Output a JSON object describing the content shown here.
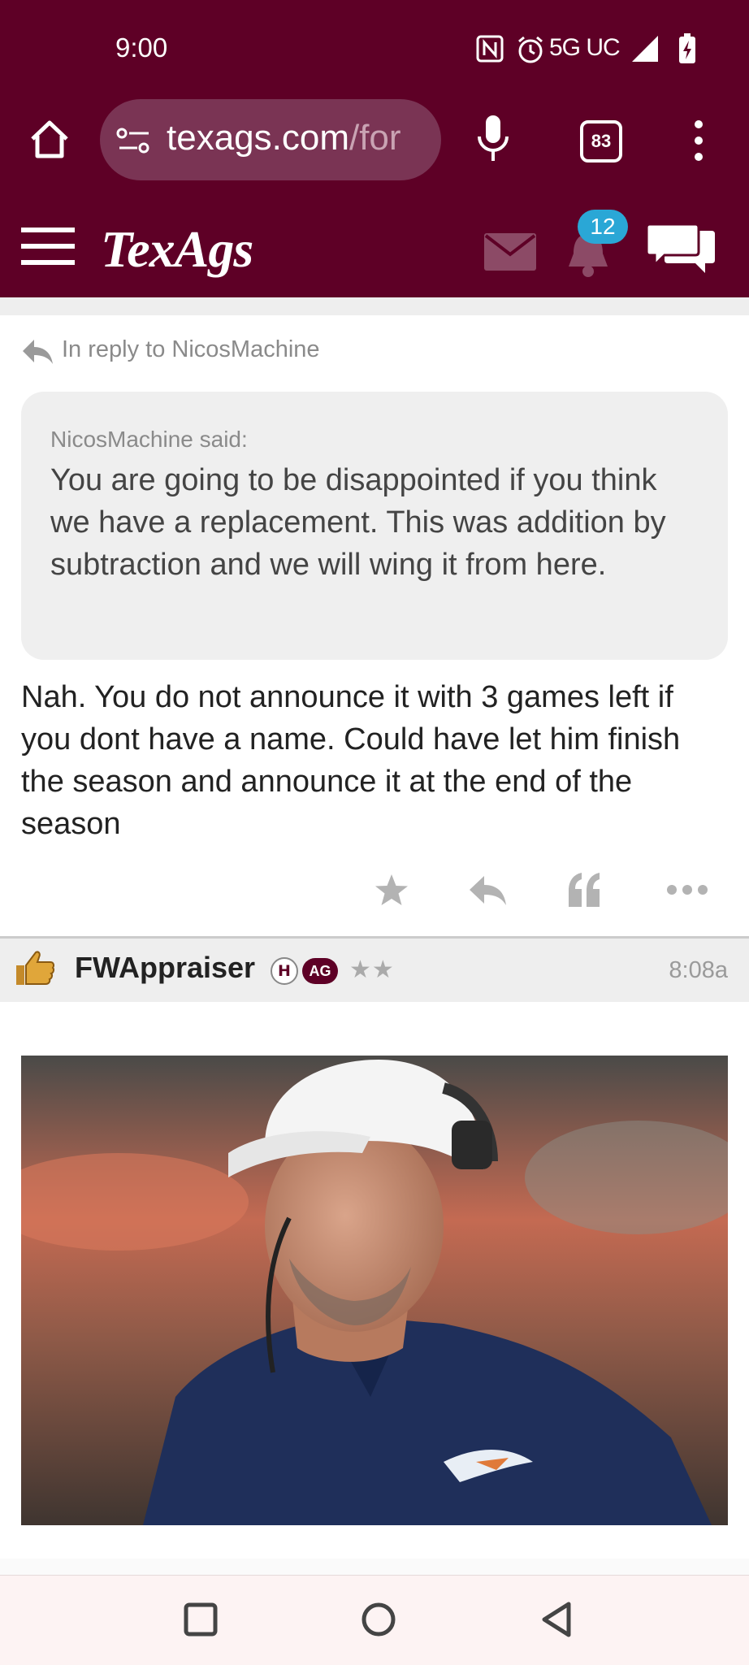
{
  "status_bar": {
    "time": "9:00",
    "network": "5G UC",
    "icons": [
      "nfc-icon",
      "alarm-icon",
      "signal-icon",
      "battery-charging-icon"
    ]
  },
  "browser": {
    "url_host": "texags.com",
    "url_path": "/for",
    "tab_count": "83",
    "icons": [
      "home-icon",
      "site-info-icon",
      "mic-icon",
      "tabs-icon",
      "more-vert-icon"
    ]
  },
  "site_header": {
    "logo": "TexAgs",
    "notifications_count": "12",
    "icons": [
      "hamburger-menu-icon",
      "mail-icon",
      "bell-icon",
      "chat-icon"
    ]
  },
  "post": {
    "reply_to": "In reply to NicosMachine",
    "quote_author": "NicosMachine said:",
    "quote_text": "You are going to be disappointed if you think we have a replacement. This was addition by subtraction and we will wing it from here.",
    "body": "Nah. You do not announce it with 3 games left if you dont have a name. Could have let him finish the season and announce it at the end of the season",
    "actions": [
      "star-icon",
      "reply-icon",
      "quote-icon",
      "more-horiz-icon"
    ]
  },
  "next_post": {
    "author": "FWAppraiser",
    "badge_h": "H",
    "badge_ag": "AG",
    "stars": "★★",
    "time": "8:08a",
    "icons": [
      "thumbs-up-avatar-icon"
    ],
    "image_desc_icon": "coach-photo"
  },
  "colors": {
    "brand": "#5e0026",
    "notification_badge": "#2aa7d6",
    "quote_bg": "#efefef"
  },
  "nav_bar": {
    "icons": [
      "recents-square-icon",
      "home-circle-icon",
      "back-triangle-icon"
    ]
  }
}
